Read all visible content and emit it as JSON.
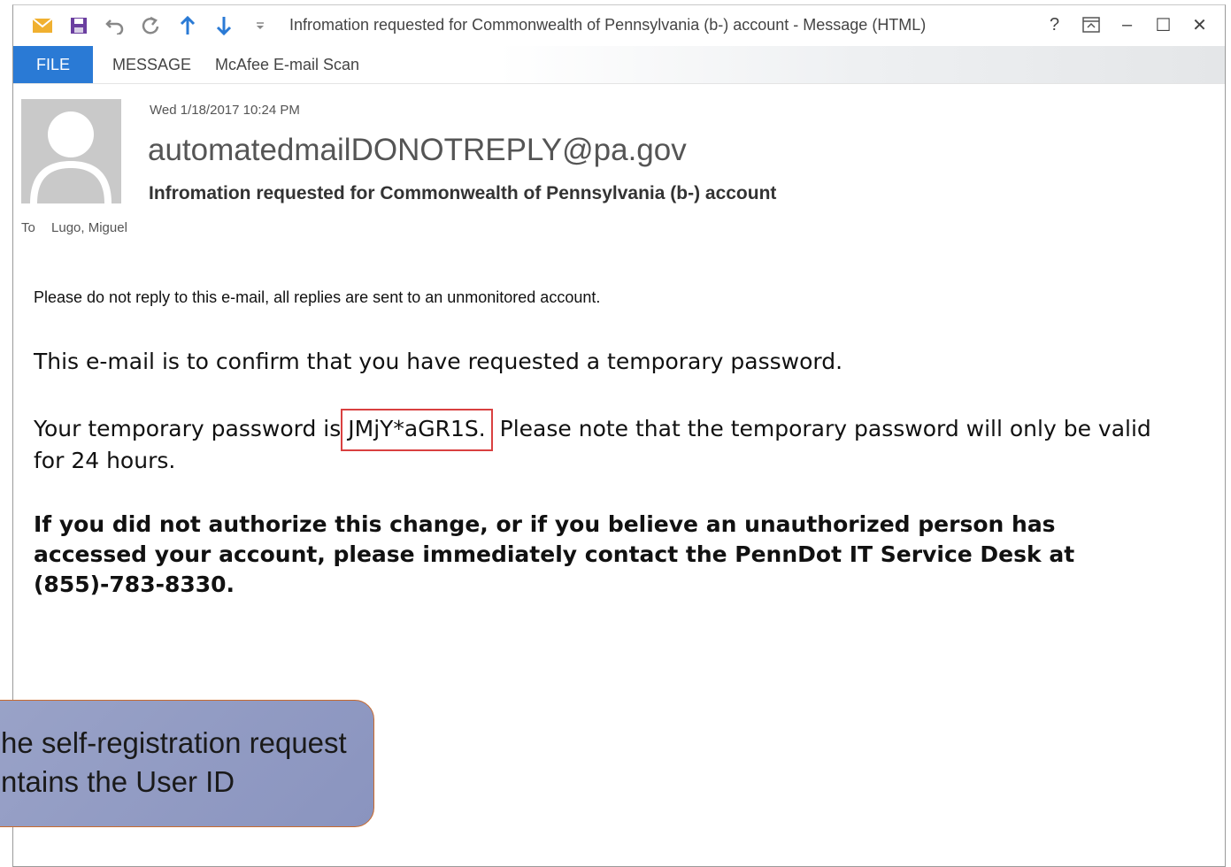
{
  "window": {
    "title": "Infromation requested for Commonwealth of Pennsylvania (b-) account - Message (HTML)",
    "controls": {
      "help": "?",
      "ribbon_toggle": "⊼",
      "minimize": "–",
      "maximize": "☐",
      "close": "✕"
    }
  },
  "ribbon": {
    "tabs": [
      {
        "label": "FILE",
        "active": true
      },
      {
        "label": "MESSAGE"
      },
      {
        "label": "McAfee E-mail Scan"
      }
    ]
  },
  "message": {
    "date": "Wed 1/18/2017 10:24 PM",
    "sender": "automatedmailDONOTREPLY@pa.gov",
    "subject": "Infromation requested for Commonwealth of Pennsylvania (b-) account",
    "to_label": "To",
    "to_value": "Lugo, Miguel"
  },
  "body": {
    "line1": "Please do not reply to this e-mail, all replies are sent to an unmonitored account.",
    "line2": "This e-mail is to confirm that you have requested a temporary password.",
    "line3_prefix": "Your temporary password is",
    "temp_password": "JMjY*aGR1S.",
    "line3_suffix": "Please note that the temporary password will only be valid for 24 hours.",
    "warning": "If you did not authorize this change, or if you believe an unauthorized person has accessed your account, please immediately contact the PennDot IT Service Desk  at (855)-783-8330."
  },
  "callout": {
    "line1": "he self-registration request",
    "line2": "ntains the User ID"
  },
  "colors": {
    "file_tab": "#2a7ad5",
    "highlight_border": "#d94040",
    "callout_fill": "#9aa3c8",
    "callout_border": "#c96a2c"
  }
}
